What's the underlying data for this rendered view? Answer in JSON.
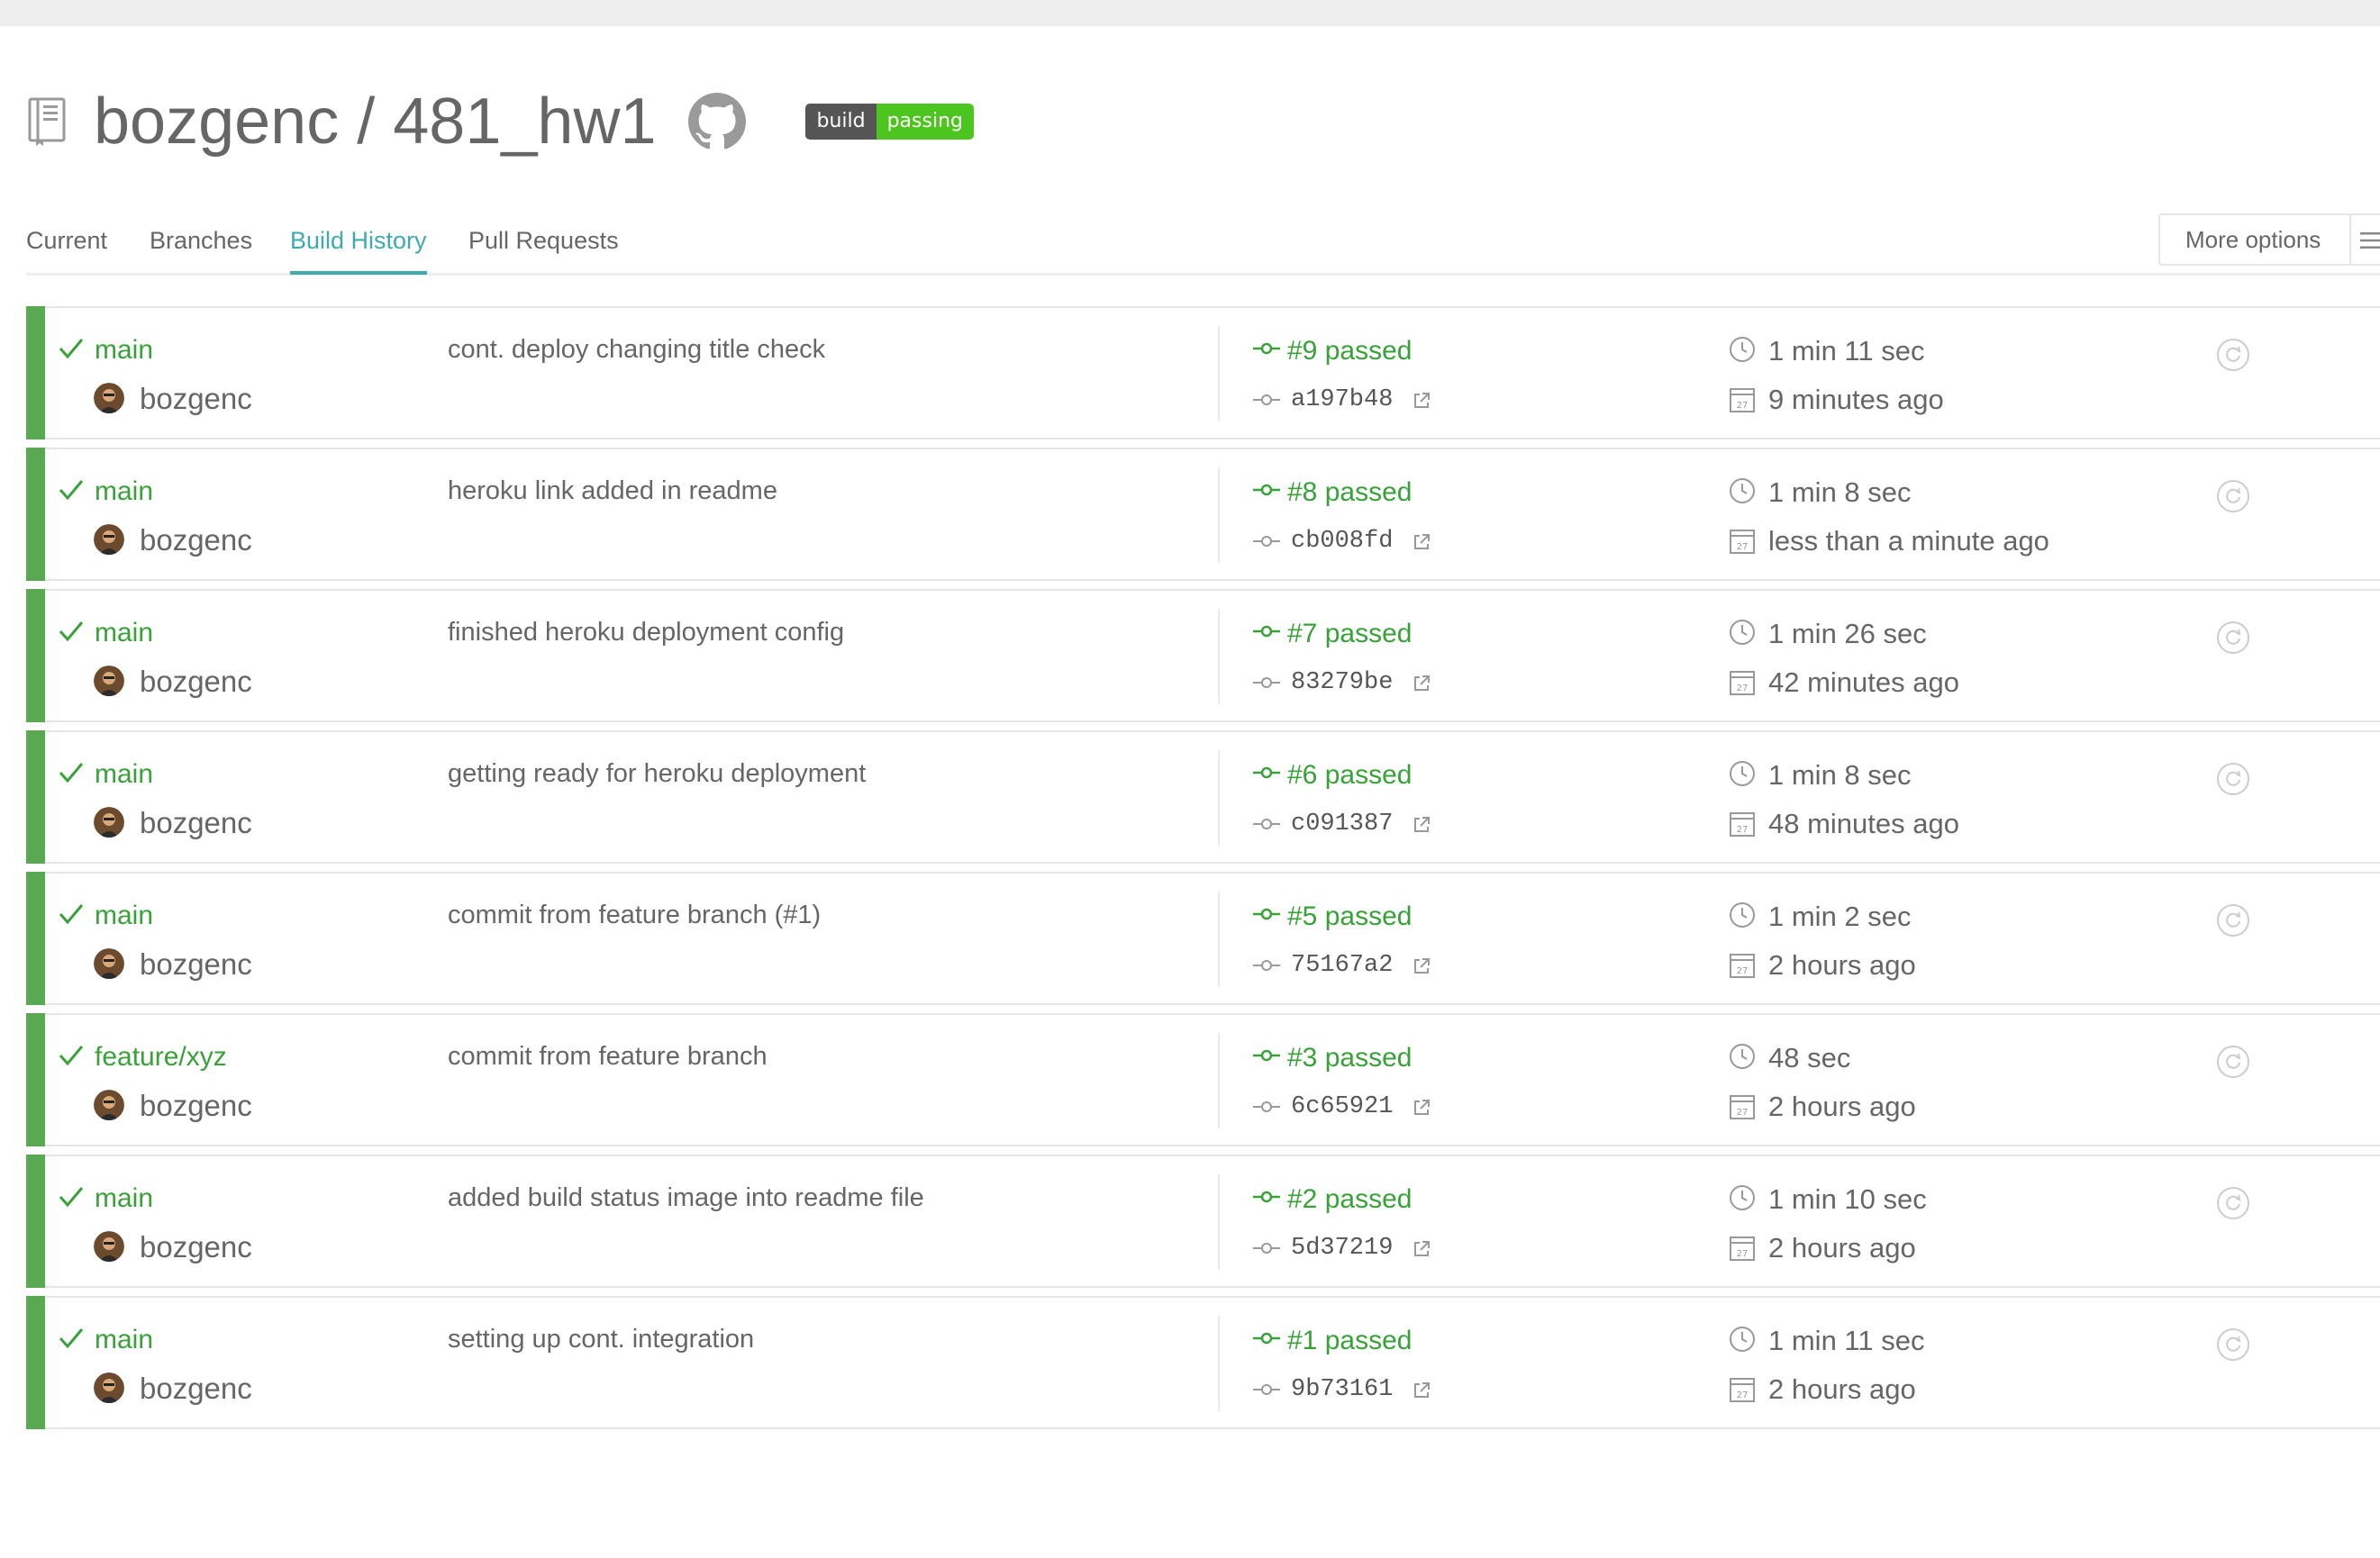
{
  "repo": {
    "owner": "bozgenc",
    "separator": " / ",
    "name": "481_hw1",
    "title": "bozgenc / 481_hw1",
    "badge": {
      "label": "build",
      "status": "passing",
      "status_color": "#4cc61e"
    }
  },
  "tabs": [
    {
      "label": "Current",
      "active": false
    },
    {
      "label": "Branches",
      "active": false
    },
    {
      "label": "Build History",
      "active": true
    },
    {
      "label": "Pull Requests",
      "active": false
    }
  ],
  "more_options": {
    "label": "More options",
    "icon": "hamburger-menu-icon"
  },
  "colors": {
    "passed": "#38a239",
    "accent": "#3eaaaf",
    "row_bar": "#58a951"
  },
  "builds": [
    {
      "branch": "main",
      "author": "bozgenc",
      "message": "cont. deploy changing title check",
      "build": "#9 passed",
      "commit": "a197b48",
      "duration": "1 min 11 sec",
      "finished": "9 minutes ago",
      "status": "passed"
    },
    {
      "branch": "main",
      "author": "bozgenc",
      "message": "heroku link added in readme",
      "build": "#8 passed",
      "commit": "cb008fd",
      "duration": "1 min 8 sec",
      "finished": "less than a minute ago",
      "status": "passed"
    },
    {
      "branch": "main",
      "author": "bozgenc",
      "message": "finished heroku deployment config",
      "build": "#7 passed",
      "commit": "83279be",
      "duration": "1 min 26 sec",
      "finished": "42 minutes ago",
      "status": "passed"
    },
    {
      "branch": "main",
      "author": "bozgenc",
      "message": "getting ready for heroku deployment",
      "build": "#6 passed",
      "commit": "c091387",
      "duration": "1 min 8 sec",
      "finished": "48 minutes ago",
      "status": "passed"
    },
    {
      "branch": "main",
      "author": "bozgenc",
      "message": "commit from feature branch (#1)",
      "build": "#5 passed",
      "commit": "75167a2",
      "duration": "1 min 2 sec",
      "finished": "2 hours ago",
      "status": "passed"
    },
    {
      "branch": "feature/xyz",
      "author": "bozgenc",
      "message": "commit from feature branch",
      "build": "#3 passed",
      "commit": "6c65921",
      "duration": "48 sec",
      "finished": "2 hours ago",
      "status": "passed"
    },
    {
      "branch": "main",
      "author": "bozgenc",
      "message": "added build status image into readme file",
      "build": "#2 passed",
      "commit": "5d37219",
      "duration": "1 min 10 sec",
      "finished": "2 hours ago",
      "status": "passed"
    },
    {
      "branch": "main",
      "author": "bozgenc",
      "message": "setting up cont. integration",
      "build": "#1 passed",
      "commit": "9b73161",
      "duration": "1 min 11 sec",
      "finished": "2 hours ago",
      "status": "passed"
    }
  ]
}
